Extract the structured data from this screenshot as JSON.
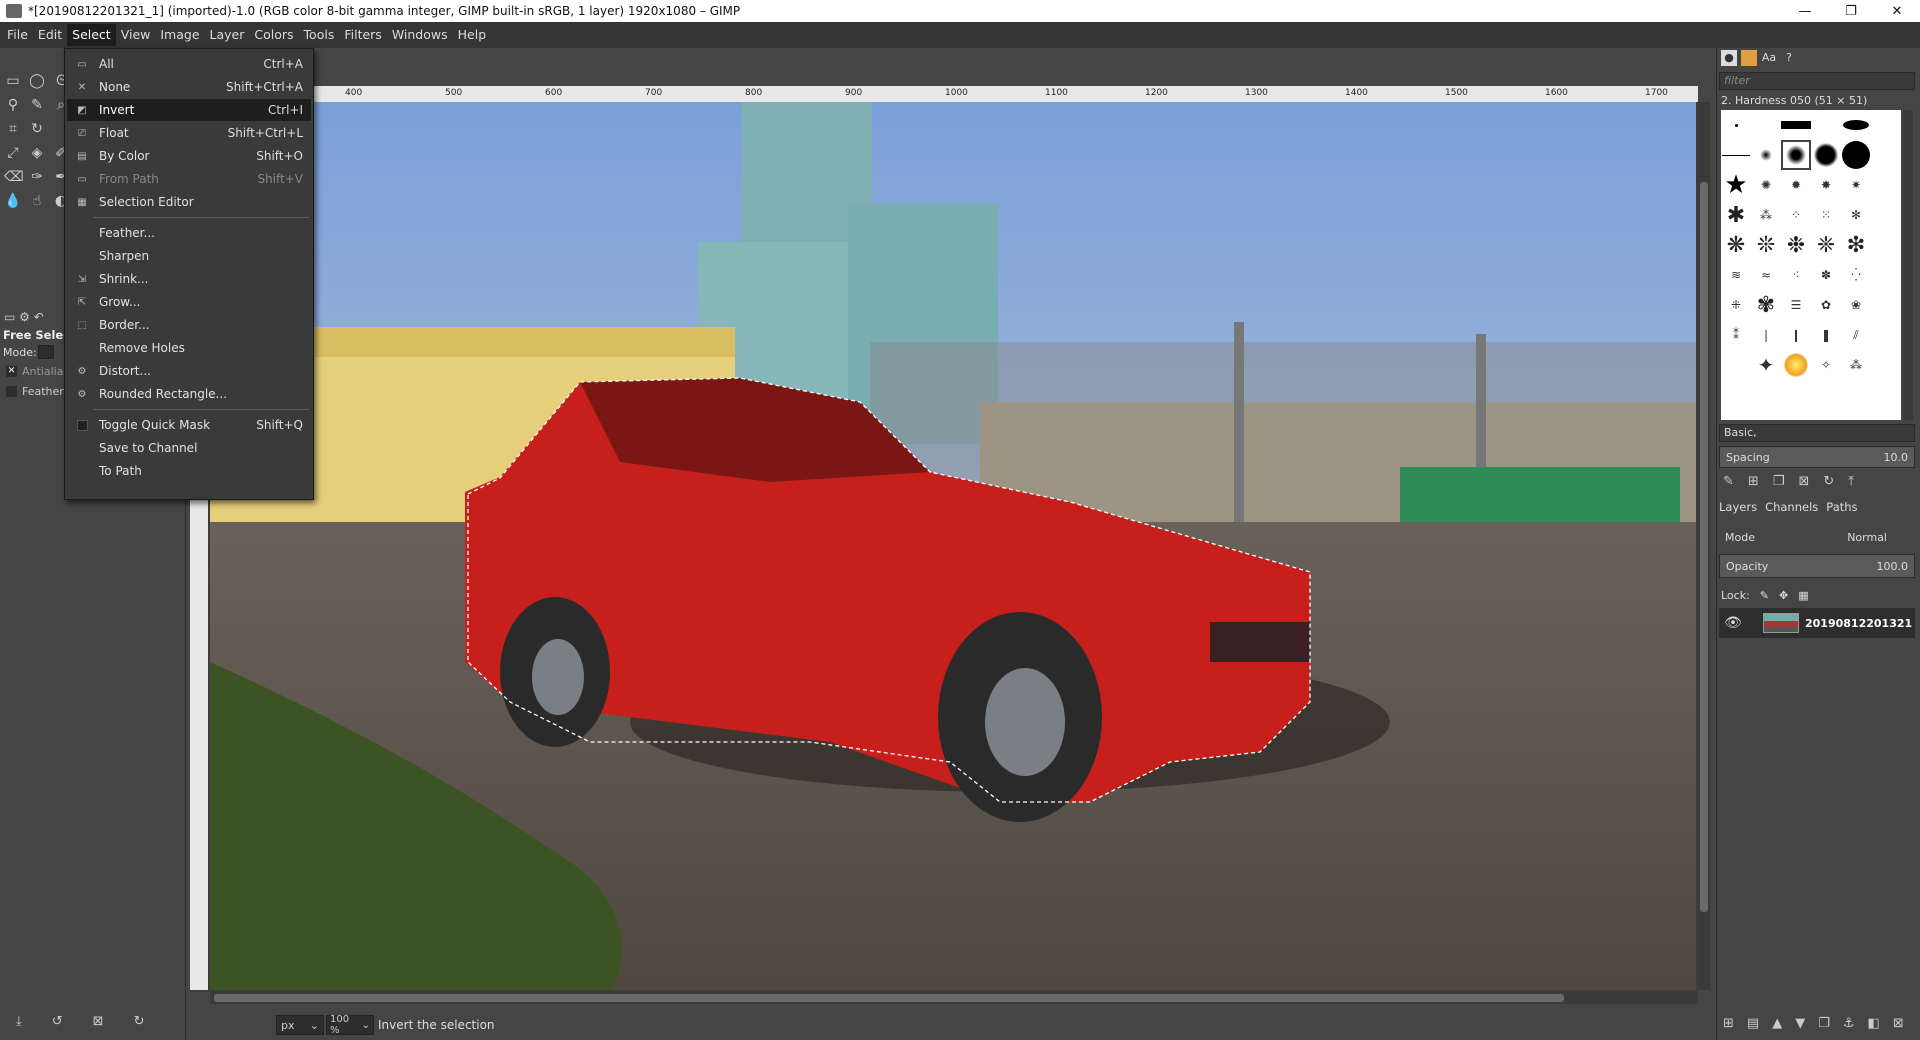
{
  "window": {
    "title": "*[20190812201321_1] (imported)-1.0 (RGB color 8-bit gamma integer, GIMP built-in sRGB, 1 layer) 1920x1080 – GIMP"
  },
  "menubar": [
    "File",
    "Edit",
    "Select",
    "View",
    "Image",
    "Layer",
    "Colors",
    "Tools",
    "Filters",
    "Windows",
    "Help"
  ],
  "select_menu": {
    "items": [
      {
        "label": "All",
        "shortcut": "Ctrl+A",
        "icon": "select-all-icon"
      },
      {
        "label": "None",
        "shortcut": "Shift+Ctrl+A",
        "icon": "select-none-icon"
      },
      {
        "label": "Invert",
        "shortcut": "Ctrl+I",
        "icon": "invert-icon",
        "highlighted": true
      },
      {
        "label": "Float",
        "shortcut": "Shift+Ctrl+L",
        "icon": "float-icon"
      },
      {
        "label": "By Color",
        "shortcut": "Shift+O",
        "icon": "by-color-icon"
      },
      {
        "label": "From Path",
        "shortcut": "Shift+V",
        "icon": "from-path-icon",
        "disabled": true
      },
      {
        "label": "Selection Editor",
        "shortcut": "",
        "icon": "selection-editor-icon"
      },
      {
        "label": "Feather...",
        "shortcut": ""
      },
      {
        "label": "Sharpen",
        "shortcut": ""
      },
      {
        "label": "Shrink...",
        "shortcut": "",
        "icon": "shrink-icon"
      },
      {
        "label": "Grow...",
        "shortcut": "",
        "icon": "grow-icon"
      },
      {
        "label": "Border...",
        "shortcut": "",
        "icon": "border-icon"
      },
      {
        "label": "Remove Holes",
        "shortcut": ""
      },
      {
        "label": "Distort...",
        "shortcut": "",
        "icon": "distort-icon"
      },
      {
        "label": "Rounded Rectangle...",
        "shortcut": "",
        "icon": "rounded-rect-icon"
      },
      {
        "label": "Toggle Quick Mask",
        "shortcut": "Shift+Q",
        "icon": "quick-mask-icon"
      },
      {
        "label": "Save to Channel",
        "shortcut": ""
      },
      {
        "label": "To Path",
        "shortcut": ""
      }
    ]
  },
  "tool_options": {
    "title": "Free Select",
    "mode_label": "Mode:",
    "antialias": "Antialias",
    "feather": "Feather"
  },
  "ruler": {
    "labels": [
      "400",
      "500",
      "600",
      "700",
      "800",
      "900",
      "1000",
      "1100",
      "1200",
      "1300",
      "1400",
      "1500",
      "1600",
      "1700"
    ]
  },
  "statusbar": {
    "unit": "px",
    "zoom": "100 %",
    "message": "Invert the selection"
  },
  "brushes": {
    "filter_placeholder": "filter",
    "selected_brush": "2. Hardness 050 (51 × 51)",
    "preset": "Basic,",
    "spacing_label": "Spacing",
    "spacing_value": "10.0"
  },
  "layers": {
    "tabs": [
      "Layers",
      "Channels",
      "Paths"
    ],
    "mode_label": "Mode",
    "mode_value": "Normal",
    "opacity_label": "Opacity",
    "opacity_value": "100.0",
    "lock_label": "Lock:",
    "layer_name": "20190812201321"
  }
}
